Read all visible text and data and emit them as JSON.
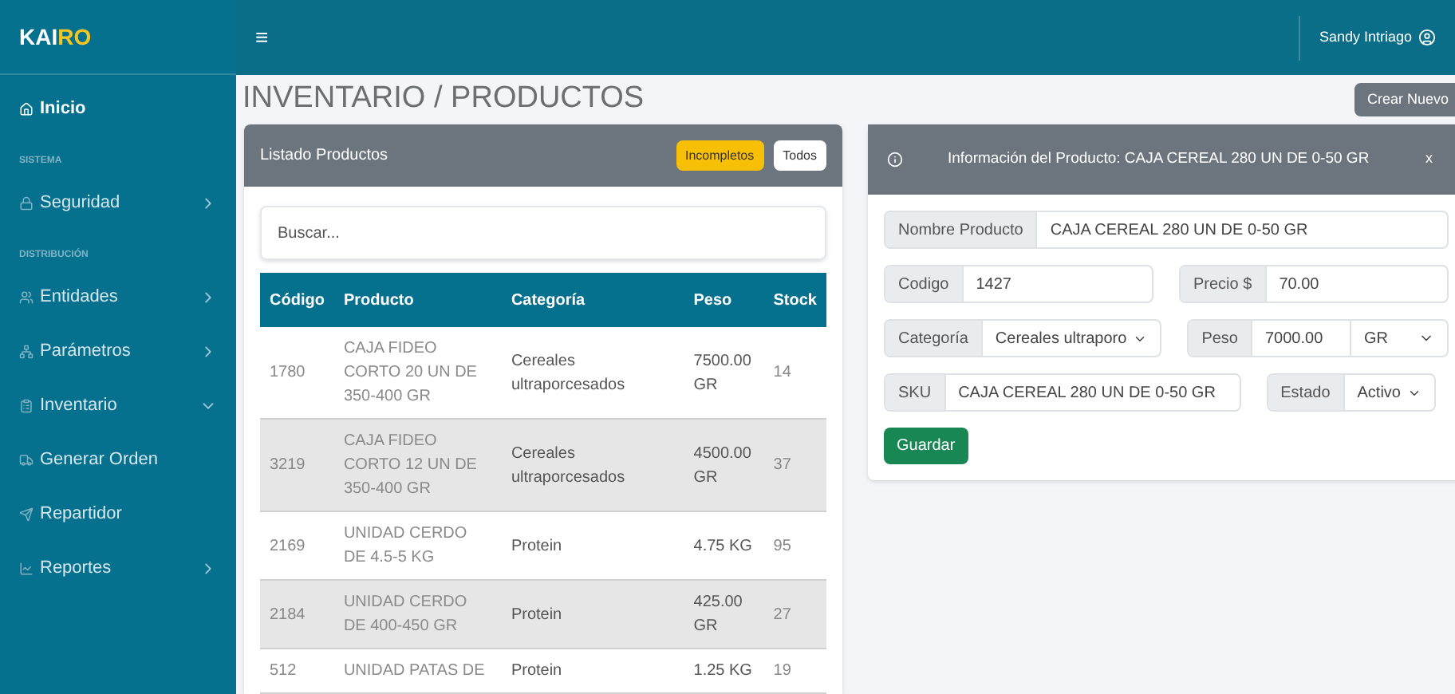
{
  "brand": {
    "first": "KAI",
    "accent": "RO"
  },
  "topbar": {
    "menu_glyph": "≡",
    "user": "Sandy Intriago"
  },
  "sidebar": {
    "items": [
      {
        "kind": "link",
        "label": "Inicio",
        "active": true
      },
      {
        "kind": "header",
        "label": "SISTEMA"
      },
      {
        "kind": "menu",
        "label": "Seguridad",
        "expanded": false
      },
      {
        "kind": "header",
        "label": "DISTRIBUCIÓN"
      },
      {
        "kind": "menu",
        "label": "Entidades",
        "expanded": false
      },
      {
        "kind": "menu",
        "label": "Parámetros",
        "expanded": false
      },
      {
        "kind": "menu",
        "label": "Inventario",
        "expanded": true
      },
      {
        "kind": "link",
        "label": "Generar Orden",
        "active": false
      },
      {
        "kind": "link",
        "label": "Repartidor",
        "active": false
      },
      {
        "kind": "menu",
        "label": "Reportes",
        "expanded": false
      }
    ]
  },
  "page_title": "INVENTARIO / PRODUCTOS",
  "create_button": "Crear Nuevo",
  "list_panel": {
    "title": "Listado Productos",
    "filters": [
      {
        "label": "Incompletos",
        "selected": true
      },
      {
        "label": "Todos",
        "selected": false
      }
    ],
    "search": {
      "placeholder": "Buscar..."
    },
    "table": {
      "columns": [
        "Código",
        "Producto",
        "Categoría",
        "Peso",
        "Stock"
      ],
      "rows": [
        [
          "1780",
          "CAJA FIDEO CORTO 20 UN DE 350-400 GR",
          "Cereales ultraporcesados",
          "7500.00 GR",
          "14"
        ],
        [
          "3219",
          "CAJA FIDEO CORTO 12 UN DE 350-400 GR",
          "Cereales ultraporcesados",
          "4500.00 GR",
          "37"
        ],
        [
          "2169",
          "UNIDAD CERDO DE 4.5-5 KG",
          "Protein",
          "4.75 KG",
          "95"
        ],
        [
          "2184",
          "UNIDAD CERDO DE 400-450 GR",
          "Protein",
          "425.00 GR",
          "27"
        ],
        [
          "512",
          "UNIDAD PATAS DE",
          "Protein",
          "1.25 KG",
          "19"
        ]
      ]
    }
  },
  "detail_panel": {
    "title": "Información del Producto: CAJA CEREAL 280 UN DE 0-50 GR",
    "close": "x",
    "rows": [
      [
        {
          "kind": "input",
          "label": "Nombre Producto",
          "value": "CAJA CEREAL 280 UN DE 0-50 GR"
        }
      ],
      [
        {
          "kind": "input",
          "label": "Codigo",
          "value": "1427"
        },
        {
          "kind": "input",
          "label": "Precio $",
          "value": "70.00"
        }
      ],
      [
        {
          "kind": "select",
          "label": "Categoría",
          "value": "Cereales ultraporo"
        },
        {
          "kind": "unit",
          "label": "Peso",
          "value": "7000.00",
          "unit": "GR"
        }
      ],
      [
        {
          "kind": "input",
          "label": "SKU",
          "value": "CAJA CEREAL 280 UN DE 0-50 GR"
        },
        {
          "kind": "select",
          "label": "Estado",
          "value": "Activo"
        }
      ]
    ],
    "save_button": "Guardar"
  }
}
